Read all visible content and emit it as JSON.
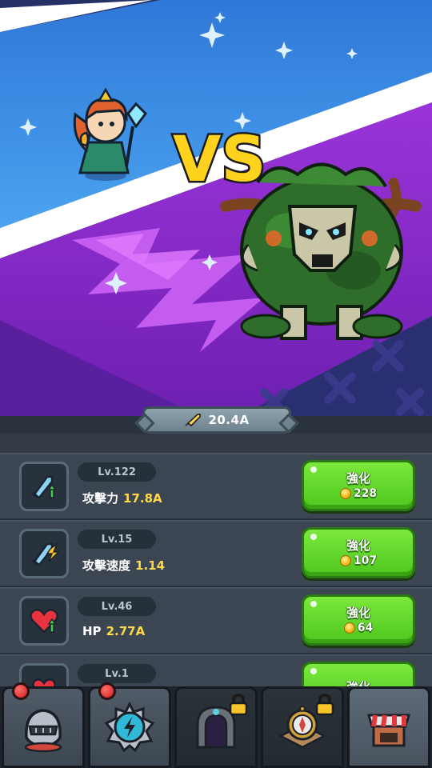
{
  "battle": {
    "vs_label": "VS",
    "power_value": "20.4A",
    "colors": {
      "sky": "#3a8fe6",
      "purple": "#8b2fd1",
      "vs_yellow": "#ffd21e"
    }
  },
  "upgrades": [
    {
      "icon": "sword-up-icon",
      "level": "Lv.122",
      "stat_name": "攻擊力",
      "stat_value": "17.8A",
      "button_label": "強化",
      "cost": "228"
    },
    {
      "icon": "sword-speed-icon",
      "level": "Lv.15",
      "stat_name": "攻擊速度",
      "stat_value": "1.14",
      "button_label": "強化",
      "cost": "107"
    },
    {
      "icon": "heart-up-icon",
      "level": "Lv.46",
      "stat_name": "HP",
      "stat_value": "2.77A",
      "button_label": "強化",
      "cost": "64"
    },
    {
      "icon": "heart-regen-icon",
      "level": "Lv.1",
      "stat_name": "",
      "stat_value": "",
      "button_label": "強化",
      "cost": ""
    }
  ],
  "nav": {
    "tabs": [
      {
        "name": "helmet-tab",
        "icon": "knight-helmet-icon",
        "notification": true,
        "locked": false
      },
      {
        "name": "skill-tab",
        "icon": "lightning-badge-icon",
        "notification": true,
        "locked": false
      },
      {
        "name": "dungeon-tab",
        "icon": "stone-gate-icon",
        "notification": false,
        "locked": true
      },
      {
        "name": "compass-tab",
        "icon": "compass-icon",
        "notification": false,
        "locked": true
      },
      {
        "name": "shop-tab",
        "icon": "shop-stall-icon",
        "notification": false,
        "locked": false
      }
    ]
  }
}
